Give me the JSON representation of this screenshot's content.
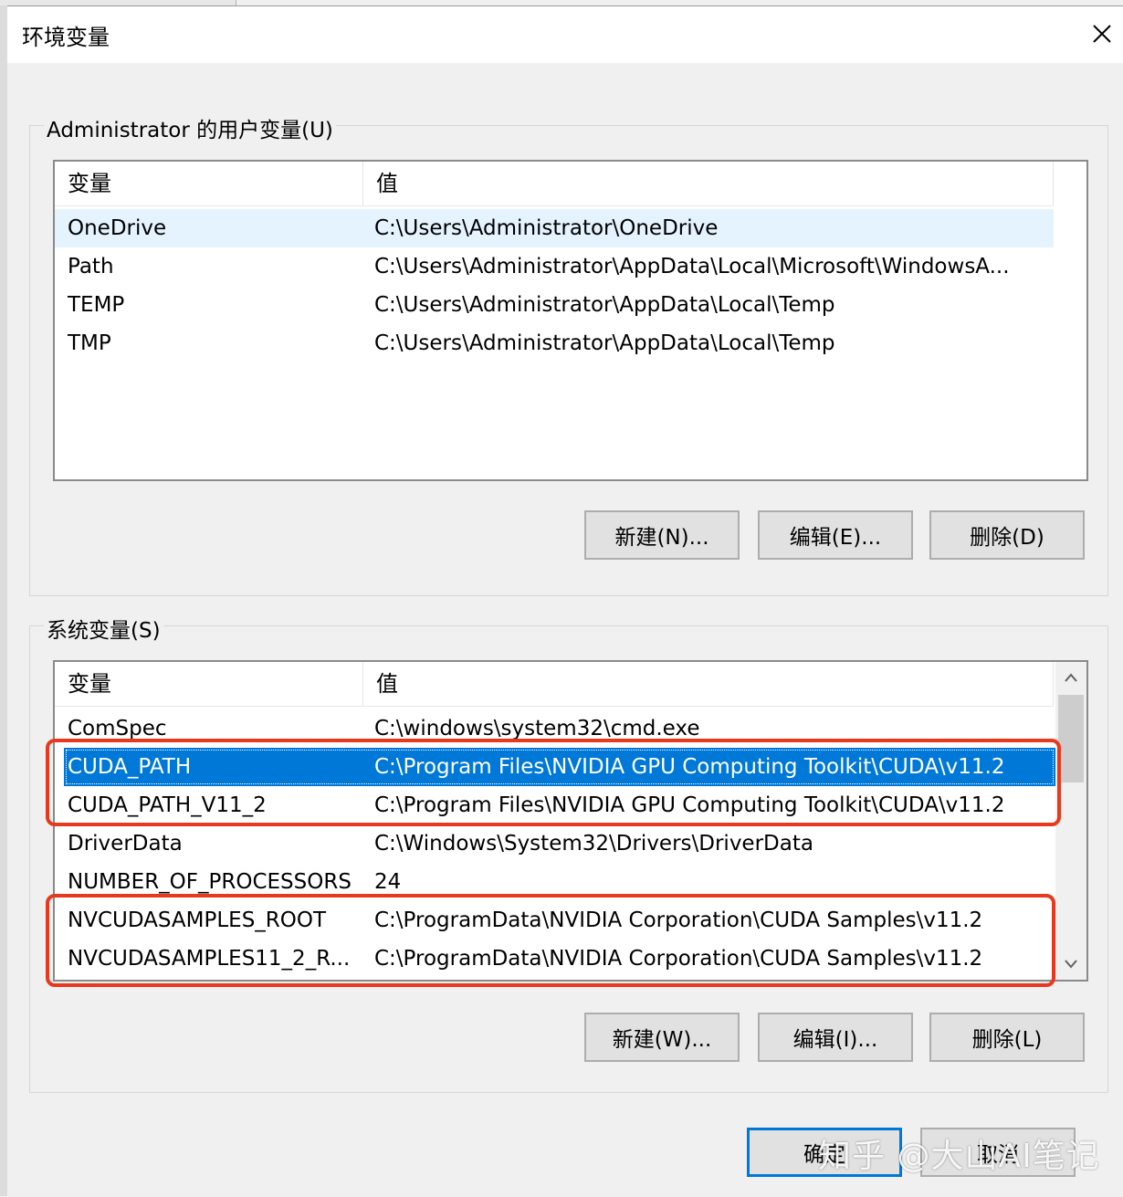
{
  "window": {
    "title": "环境变量"
  },
  "user_vars": {
    "group_label": "Administrator 的用户变量(U)",
    "col_name": "变量",
    "col_value": "值",
    "rows": [
      {
        "name": "OneDrive",
        "value": "C:\\Users\\Administrator\\OneDrive"
      },
      {
        "name": "Path",
        "value": "C:\\Users\\Administrator\\AppData\\Local\\Microsoft\\WindowsA..."
      },
      {
        "name": "TEMP",
        "value": "C:\\Users\\Administrator\\AppData\\Local\\Temp"
      },
      {
        "name": "TMP",
        "value": "C:\\Users\\Administrator\\AppData\\Local\\Temp"
      }
    ],
    "new_label": "新建(N)...",
    "edit_label": "编辑(E)...",
    "delete_label": "删除(D)"
  },
  "system_vars": {
    "group_label": "系统变量(S)",
    "col_name": "变量",
    "col_value": "值",
    "rows": [
      {
        "name": "ComSpec",
        "value": "C:\\windows\\system32\\cmd.exe"
      },
      {
        "name": "CUDA_PATH",
        "value": "C:\\Program Files\\NVIDIA GPU Computing Toolkit\\CUDA\\v11.2"
      },
      {
        "name": "CUDA_PATH_V11_2",
        "value": "C:\\Program Files\\NVIDIA GPU Computing Toolkit\\CUDA\\v11.2"
      },
      {
        "name": "DriverData",
        "value": "C:\\Windows\\System32\\Drivers\\DriverData"
      },
      {
        "name": "NUMBER_OF_PROCESSORS",
        "value": "24"
      },
      {
        "name": "NVCUDASAMPLES_ROOT",
        "value": "C:\\ProgramData\\NVIDIA Corporation\\CUDA Samples\\v11.2"
      },
      {
        "name": "NVCUDASAMPLES11_2_R...",
        "value": "C:\\ProgramData\\NVIDIA Corporation\\CUDA Samples\\v11.2"
      }
    ],
    "selected_row": "CUDA_PATH",
    "new_label": "新建(W)...",
    "edit_label": "编辑(I)...",
    "delete_label": "删除(L)"
  },
  "footer": {
    "ok_label": "确定",
    "cancel_label": "取消"
  },
  "watermark": "知乎 @大山AI笔记",
  "colors": {
    "selection": "#0078d7",
    "highlight_box": "#e8391e",
    "hover": "#e5f3ff"
  },
  "icons": {
    "close": "close-icon",
    "scroll_up": "chevron-up-icon",
    "scroll_down": "chevron-down-icon"
  }
}
